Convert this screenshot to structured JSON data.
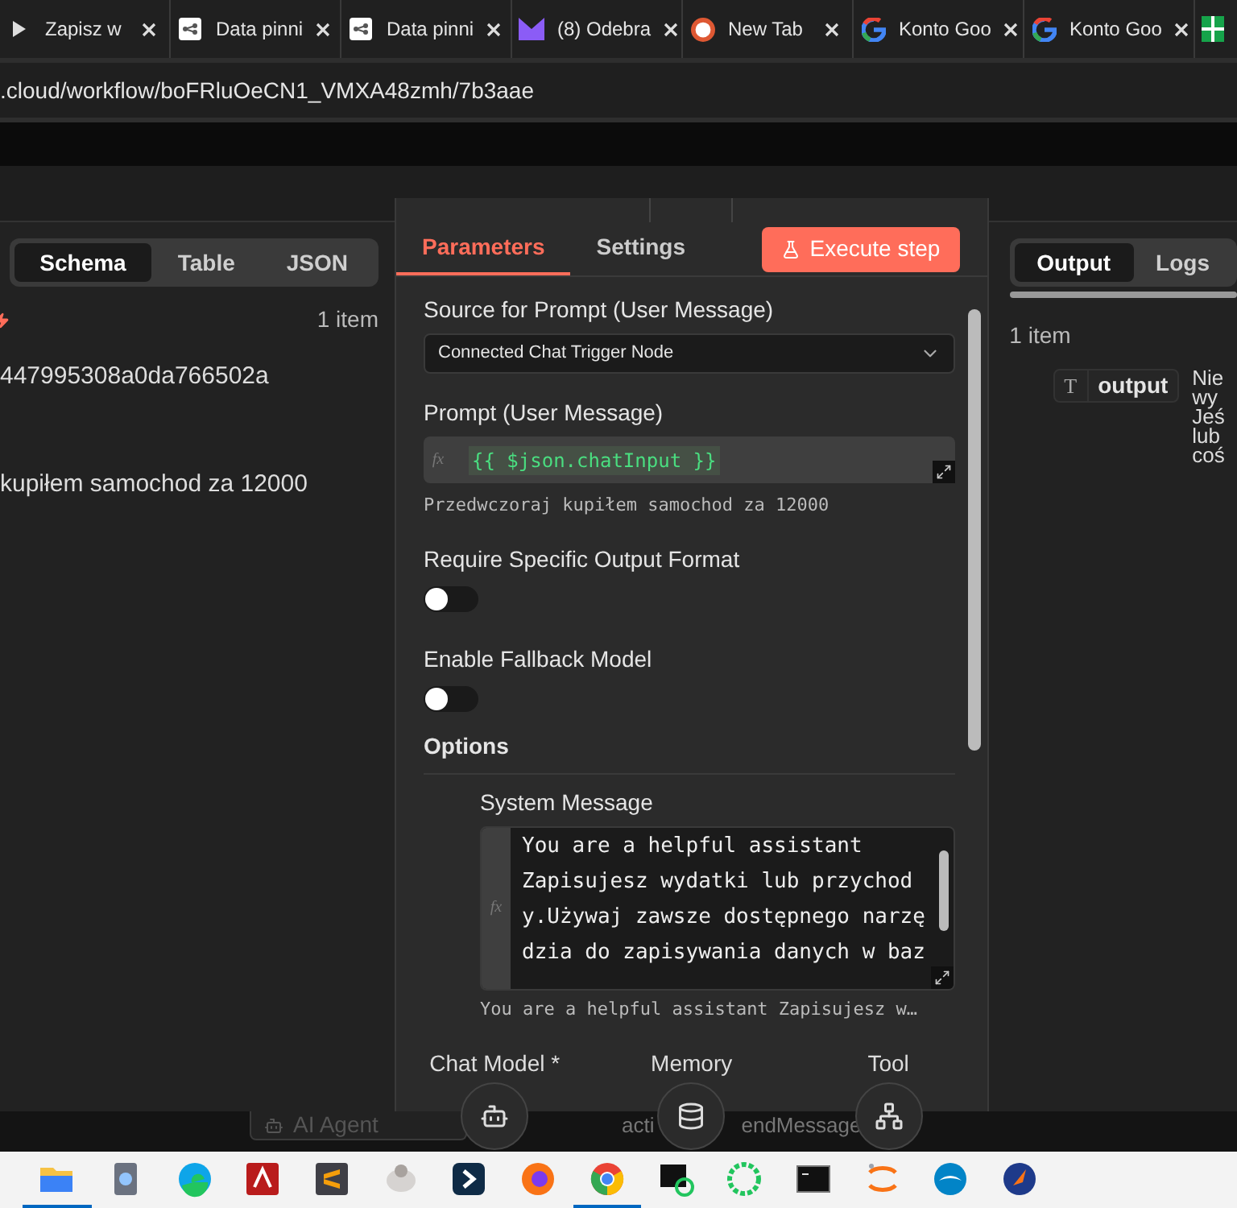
{
  "browser_tabs": [
    {
      "kind": "play",
      "title": "Zapisz w"
    },
    {
      "kind": "flow",
      "title": "Data pinni"
    },
    {
      "kind": "flow",
      "title": "Data pinni"
    },
    {
      "kind": "mail",
      "title": "(8) Odebra"
    },
    {
      "kind": "duck",
      "title": "New Tab"
    },
    {
      "kind": "google",
      "title": "Konto Goo"
    },
    {
      "kind": "google",
      "title": "Konto Goo"
    }
  ],
  "address": ".cloud/workflow/boFRluOeCN1_VMXA48zmh/7b3aae",
  "input_panel": {
    "views": [
      {
        "label": "Schema",
        "selected": true
      },
      {
        "label": "Table",
        "selected": false
      },
      {
        "label": "JSON",
        "selected": false
      }
    ],
    "count": "1 item",
    "values": [
      "447995308a0da766502a",
      "kupiłem samochod za 12000"
    ]
  },
  "node_panel": {
    "tabs": [
      {
        "label": "Parameters",
        "selected": true
      },
      {
        "label": "Settings",
        "selected": false
      }
    ],
    "execute": "Execute step",
    "source_label": "Source for Prompt (User Message)",
    "source_value": "Connected Chat Trigger Node",
    "prompt_label": "Prompt (User Message)",
    "prompt_fx": "fx",
    "prompt_expression": "{{ $json.chatInput }}",
    "prompt_preview": "Przedwczoraj kupiłem samochod za 12000",
    "switches": [
      {
        "label": "Require Specific Output Format",
        "on": false
      },
      {
        "label": "Enable Fallback Model",
        "on": false
      }
    ],
    "options_title": "Options",
    "system_label": "System Message",
    "system_fx": "fx",
    "system_value": "You are a helpful assistant\nZapisujesz wydatki lub przychod\ny.Używaj zawsze dostępnego narzę\ndzia do zapisywania danych w baz",
    "system_preview": "You are a helpful assistant Zapisujesz w…",
    "sub_nodes": [
      {
        "kind": "ai",
        "label": "Chat Model *"
      },
      {
        "kind": "database",
        "label": "Memory"
      },
      {
        "kind": "tree",
        "label": "Tool"
      }
    ]
  },
  "output_panel": {
    "views": [
      {
        "label": "Output",
        "selected": true
      },
      {
        "label": "Logs",
        "selected": false
      }
    ],
    "count": "1 item",
    "type_mark": "T",
    "field": "output",
    "value_lines": [
      "Nie",
      "wy",
      "Jeś",
      "lub",
      "coś"
    ]
  },
  "canvas": {
    "nodes": [
      {
        "kind": "agent",
        "parts": [
          "AI Agent"
        ]
      },
      {
        "kind": "action",
        "parts": [
          "acti",
          "endMessage"
        ]
      }
    ]
  },
  "taskbar": [
    {
      "kind": "folder",
      "running": true
    },
    {
      "kind": "tool",
      "running": false
    },
    {
      "kind": "edge",
      "running": false
    },
    {
      "kind": "pdf",
      "running": false
    },
    {
      "kind": "sublime",
      "running": false
    },
    {
      "kind": "pdf24",
      "running": false
    },
    {
      "kind": "arrow",
      "running": false
    },
    {
      "kind": "firefox",
      "running": false
    },
    {
      "kind": "chrome",
      "running": true
    },
    {
      "kind": "console",
      "running": false
    },
    {
      "kind": "ring",
      "running": false
    },
    {
      "kind": "terminal",
      "running": false
    },
    {
      "kind": "jupyter",
      "running": false
    },
    {
      "kind": "bird",
      "running": false
    },
    {
      "kind": "rocket",
      "running": false
    }
  ]
}
